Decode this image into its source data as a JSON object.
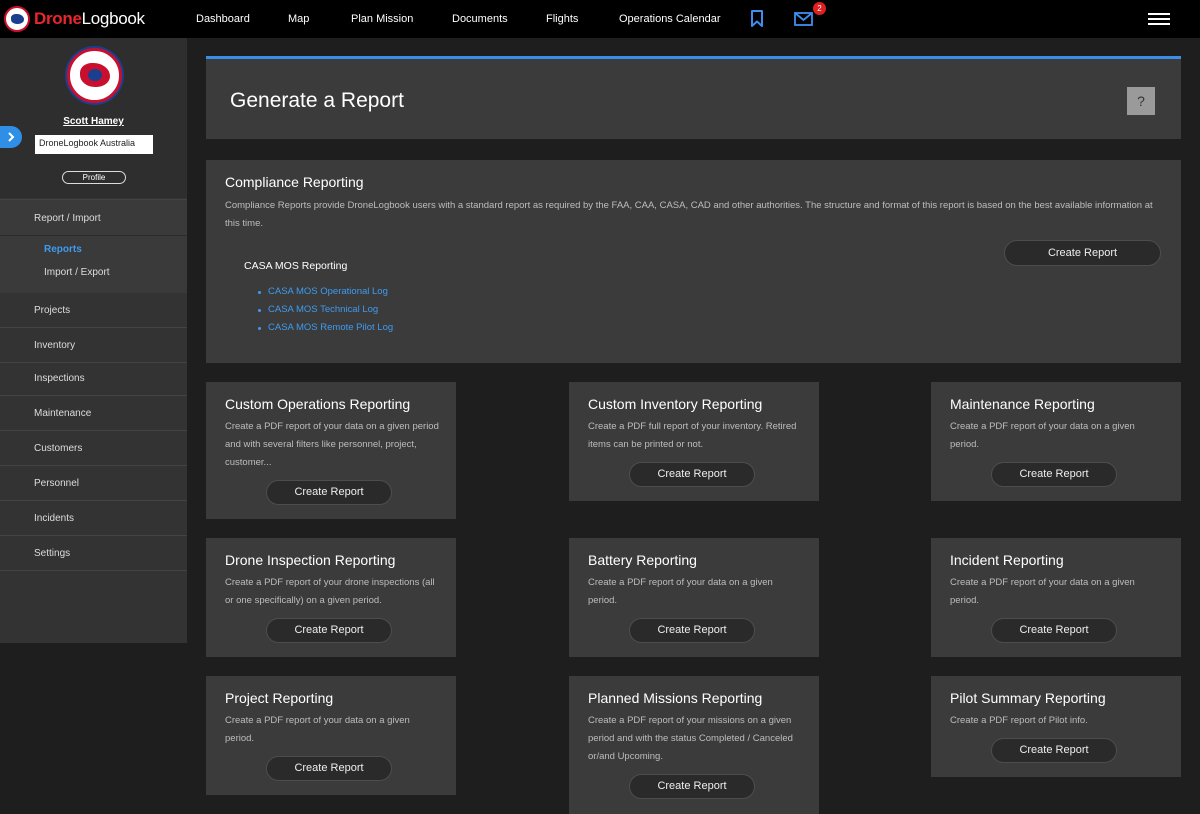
{
  "app": {
    "logo_text_a": "Drone",
    "logo_text_b": "Logbook"
  },
  "nav": {
    "items": [
      "Dashboard",
      "Map",
      "Plan Mission",
      "Documents",
      "Flights",
      "Operations Calendar"
    ],
    "mail_badge": "2"
  },
  "sidebar": {
    "user_name": "Scott Hamey",
    "org_value": "DroneLogbook Australia",
    "profile_label": "Profile",
    "section_header": "Report / Import",
    "sub_items": [
      "Reports",
      "Import / Export"
    ],
    "items": [
      "Projects",
      "Inventory",
      "Inspections",
      "Maintenance",
      "Customers",
      "Personnel",
      "Incidents",
      "Settings"
    ]
  },
  "main": {
    "title": "Generate a Report",
    "help_label": "?",
    "compliance": {
      "title": "Compliance Reporting",
      "desc": "Compliance Reports provide DroneLogbook users with a standard report as required by the FAA, CAA, CASA, CAD and other authorities. The structure and format of this report is based on the best available information at this time.",
      "button": "Create Report",
      "subtitle": "CASA MOS Reporting",
      "links": [
        "CASA MOS Operational Log",
        "CASA MOS Technical Log",
        "CASA MOS Remote Pilot Log"
      ]
    },
    "cards": [
      {
        "title": "Custom Operations Reporting",
        "desc": "Create a PDF report of your data on a given period and with several filters like personnel, project, customer...",
        "button": "Create Report"
      },
      {
        "title": "Custom Inventory Reporting",
        "desc": "Create a PDF full report of your inventory. Retired items can be printed or not.",
        "button": "Create Report"
      },
      {
        "title": "Maintenance Reporting",
        "desc": "Create a PDF report of your data on a given period.",
        "button": "Create Report"
      },
      {
        "title": "Drone Inspection Reporting",
        "desc": "Create a PDF report of your drone inspections (all or one specifically) on a given period.",
        "button": "Create Report"
      },
      {
        "title": "Battery Reporting",
        "desc": "Create a PDF report of your data on a given period.",
        "button": "Create Report"
      },
      {
        "title": "Incident Reporting",
        "desc": "Create a PDF report of your data on a given period.",
        "button": "Create Report"
      },
      {
        "title": "Project Reporting",
        "desc": "Create a PDF report of your data on a given period.",
        "button": "Create Report"
      },
      {
        "title": "Planned Missions Reporting",
        "desc": "Create a PDF report of your missions on a given period and with the status Completed / Canceled or/and Upcoming.",
        "button": "Create Report"
      },
      {
        "title": "Pilot Summary Reporting",
        "desc": "Create a PDF report of Pilot info.",
        "button": "Create Report"
      }
    ]
  },
  "colors": {
    "accent": "#3b8ee8",
    "link": "#3e9bf0",
    "brand_red": "#e8262d",
    "panel": "#3b3b3b",
    "background": "#1e1e1e"
  }
}
